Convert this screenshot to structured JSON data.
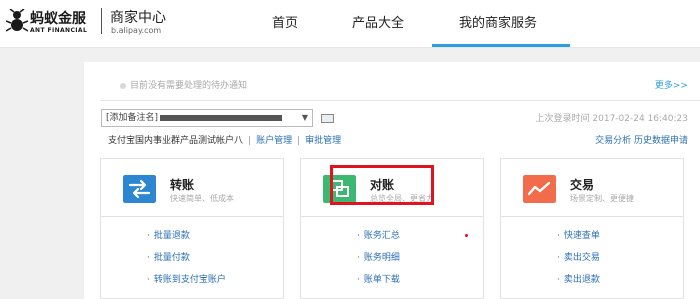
{
  "header": {
    "logo_cn": "蚂蚁金服",
    "logo_en": "ANT FINANCIAL",
    "biz_title": "商家中心",
    "biz_sub": "b.alipay.com",
    "nav": [
      {
        "label": "首页"
      },
      {
        "label": "产品大全"
      },
      {
        "label": "我的商家服务"
      }
    ],
    "active_nav": "我的商家服务",
    "accent_color": "#2aa0e0"
  },
  "notice": {
    "text": "目前没有需要处理的待办通知",
    "more": "更多>>"
  },
  "account": {
    "select_prefix": "[添加备注名]",
    "last_login": "上次登录时间 2017-02-24 16:40:23",
    "name": "支付宝国内事业群产品测试帐户八",
    "links": [
      "账户管理",
      "审批管理"
    ],
    "right_links": [
      "交易分析",
      "历史数据申请"
    ]
  },
  "cards": [
    {
      "title": "转账",
      "desc": "快速简单、低成本",
      "icon": "transfer-icon",
      "icon_color": "#2c86d2",
      "links": [
        "批量退款",
        "批量付款",
        "转账到支付宝账户"
      ]
    },
    {
      "title": "对账",
      "desc": "总览全局、更省力",
      "icon": "reconcile-icon",
      "icon_color": "#3cb872",
      "links": [
        "账务汇总",
        "账务明细",
        "账单下载"
      ]
    },
    {
      "title": "交易",
      "desc": "场景定制、更便捷",
      "icon": "trade-chart-icon",
      "icon_color": "#f26b4a",
      "links": [
        "快速查单",
        "卖出交易",
        "卖出退款"
      ]
    }
  ],
  "highlight_color": "#e0141e"
}
